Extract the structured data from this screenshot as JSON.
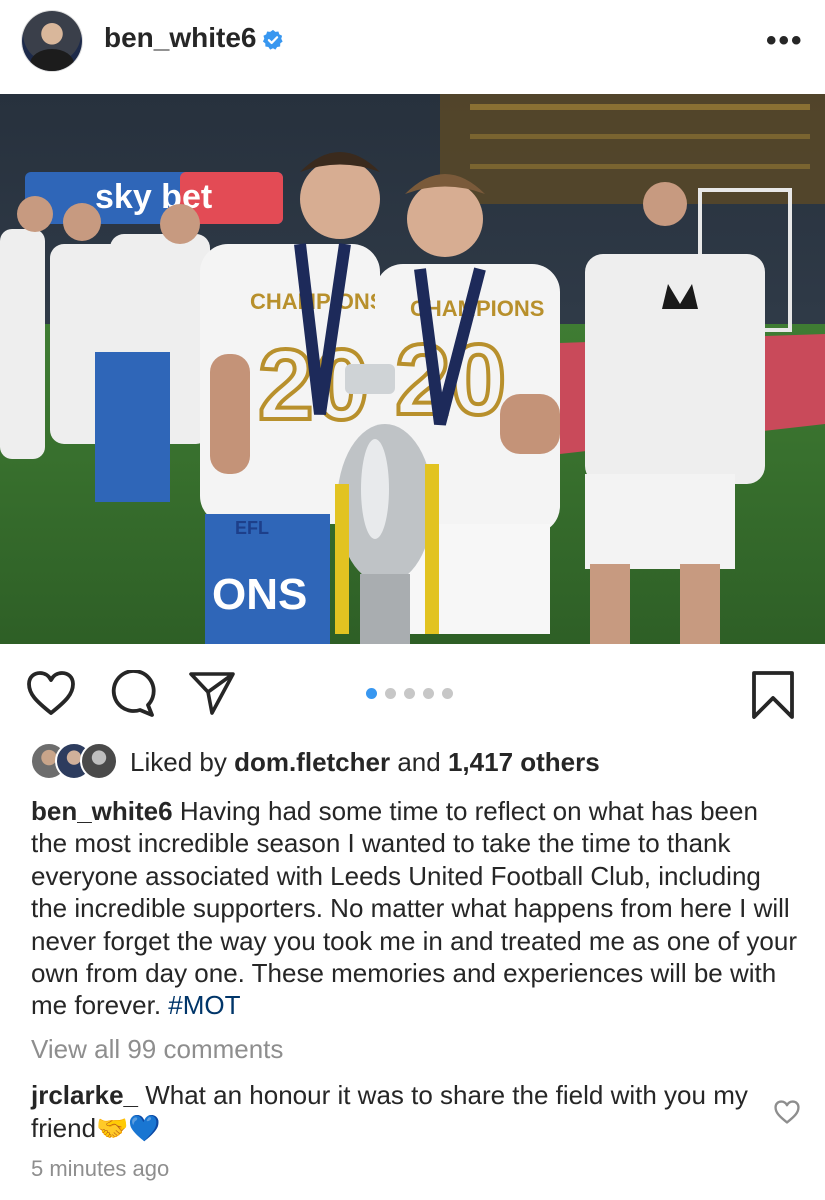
{
  "header": {
    "username": "ben_white6",
    "more_label": "•••"
  },
  "post": {
    "carousel_pages": 5,
    "carousel_active_index": 0
  },
  "likes": {
    "prefix": "Liked by",
    "user": "dom.fletcher",
    "and_text": "and",
    "count_text": "1,417 others"
  },
  "caption": {
    "username": "ben_white6",
    "text": "Having had some time to reflect on what has been the most incredible season I wanted to take the time to thank everyone associated with Leeds United Football Club, including the incredible supporters. No matter what happens from here I will never forget the way you took me in and treated me as one of your own from day one. These memories and experiences will be with me forever.",
    "hashtag": "#MOT"
  },
  "comments": {
    "view_all": "View all 99 comments",
    "top": {
      "username": "jrclarke_",
      "text": "What an honour it was to share the field with you my friend",
      "emoji": "🤝💙"
    }
  },
  "timestamp": "5 minutes ago",
  "photo": {
    "sign_text": "sky bet",
    "shirt_text_1": "CHAMPIONS",
    "shirt_text_2": "CHAMPIONS",
    "shirt_number_1": "20",
    "shirt_number_2": "20",
    "badge_text": "EFL",
    "flag_text": "ONS"
  },
  "colors": {
    "accent_blue": "#3897f0",
    "verified_blue": "#3897f0",
    "text": "#262626",
    "muted": "#8e8e8e"
  },
  "icons": [
    "verified-badge-icon",
    "more-options-icon",
    "heart-icon",
    "comment-icon",
    "share-icon",
    "bookmark-icon"
  ]
}
